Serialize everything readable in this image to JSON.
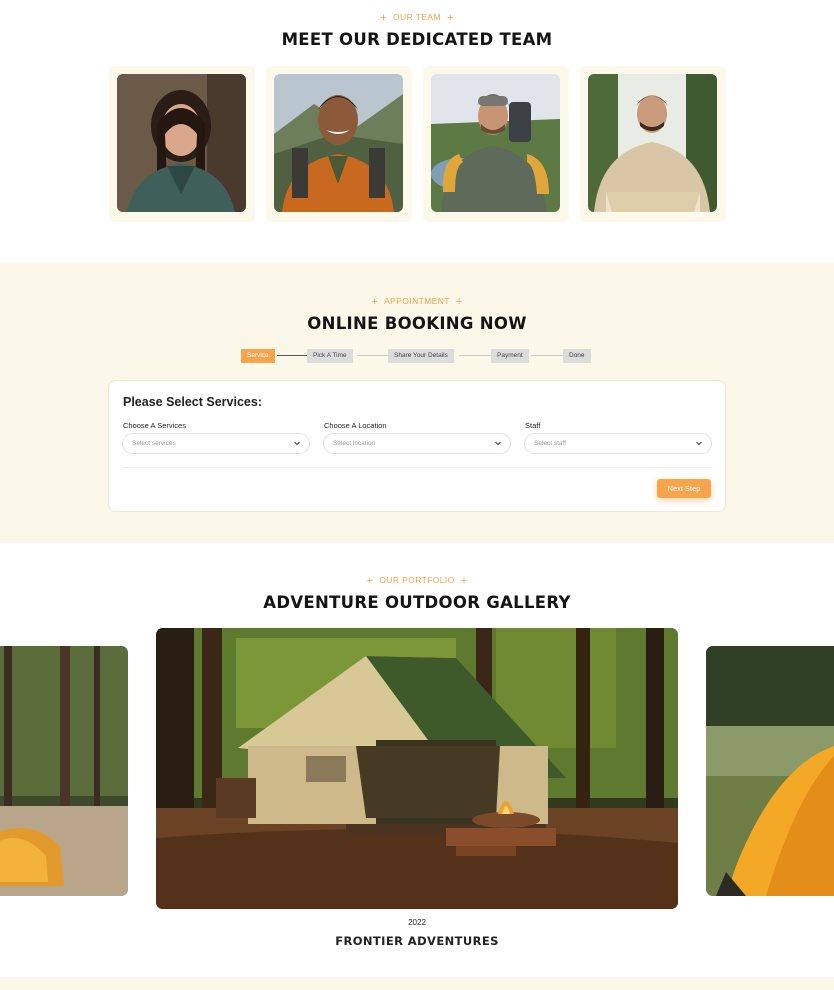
{
  "team": {
    "eyebrow": "OUR TEAM",
    "title": "MEET OUR DEDICATED TEAM",
    "members": [
      {
        "photo": "woman-with-dark-curly-hair-photo"
      },
      {
        "photo": "smiling-hiker-with-backpack-photo"
      },
      {
        "photo": "bearded-hiker-with-beanie-photo"
      },
      {
        "photo": "hiker-reading-map-photo"
      }
    ]
  },
  "booking": {
    "eyebrow": "APPOINTMENT",
    "title": "ONLINE BOOKING NOW",
    "steps": [
      {
        "label": "Service",
        "active": true
      },
      {
        "label": "Pick A Time",
        "active": false
      },
      {
        "label": "Share Your Details",
        "active": false
      },
      {
        "label": "Payment",
        "active": false
      },
      {
        "label": "Done",
        "active": false
      }
    ],
    "form": {
      "title": "Please Select Services:",
      "fields": [
        {
          "label": "Choose A Services",
          "placeholder": "Select services"
        },
        {
          "label": "Choose A Location",
          "placeholder": "Select location"
        },
        {
          "label": "Staff",
          "placeholder": "Select staff"
        }
      ],
      "next_label": "Next Step"
    }
  },
  "gallery": {
    "eyebrow": "OUR PORTFOLIO",
    "title": "ADVENTURE OUTDOOR GALLERY",
    "active_item": {
      "year": "2022",
      "title": "FRONTIER ADVENTURES"
    }
  },
  "colors": {
    "accent": "#f7a44d",
    "cream": "#fbf8ea"
  }
}
